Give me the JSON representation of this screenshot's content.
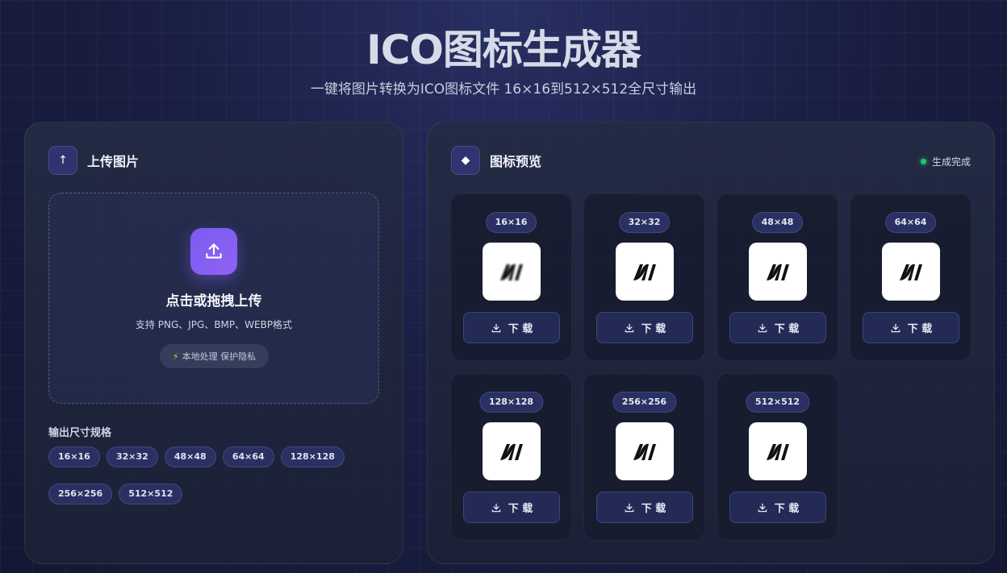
{
  "header": {
    "title": "ICO图标生成器",
    "subtitle": "一键将图片转换为ICO图标文件 16×16到512×512全尺寸输出"
  },
  "upload_panel": {
    "title": "上传图片",
    "icon": "upload-arrow-icon",
    "drop_title": "点击或拖拽上传",
    "drop_formats": "支持 PNG、JPG、BMP、WEBP格式",
    "privacy": "本地处理 保护隐私",
    "sizes_label": "输出尺寸规格",
    "sizes": [
      "16×16",
      "32×32",
      "48×48",
      "64×64",
      "128×128",
      "256×256",
      "512×512"
    ]
  },
  "preview_panel": {
    "title": "图标预览",
    "icon": "diamond-icon",
    "status": "生成完成",
    "status_color": "#22c55e",
    "download_label": "下 载",
    "cards": [
      {
        "size": "16×16"
      },
      {
        "size": "32×32"
      },
      {
        "size": "48×48"
      },
      {
        "size": "64×64"
      },
      {
        "size": "128×128"
      },
      {
        "size": "256×256"
      },
      {
        "size": "512×512"
      }
    ]
  },
  "colors": {
    "accent": "#7b5cf0",
    "chip_bg": "#2a3162",
    "panel_bg": "#242b44"
  }
}
